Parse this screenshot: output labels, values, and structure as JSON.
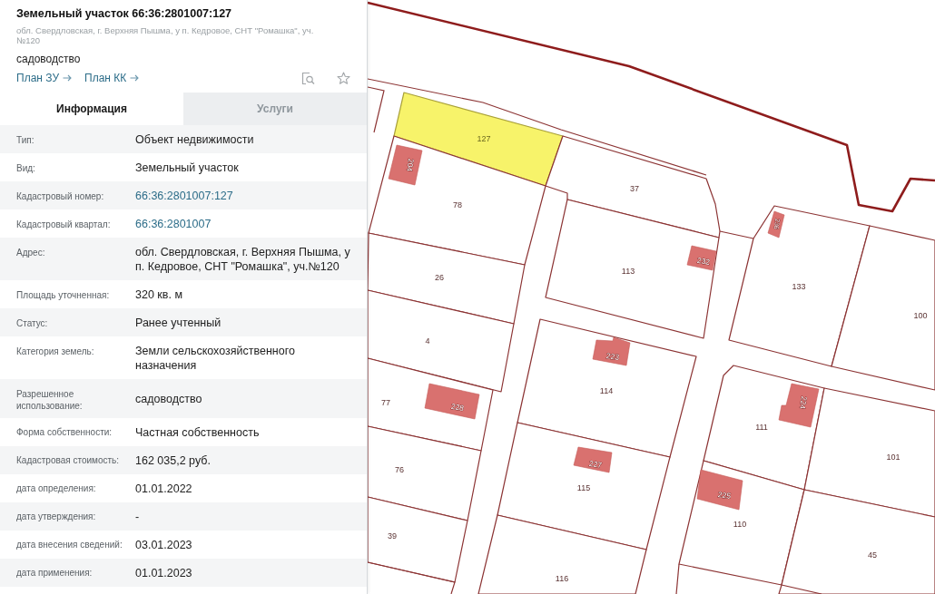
{
  "panel": {
    "title": "Земельный участок 66:36:2801007:127",
    "address": "обл. Свердловская, г. Верхняя Пышма, у п. Кедровое, СНТ \"Ромашка\", уч. №120",
    "usage": "садоводство",
    "links": [
      {
        "label": "План ЗУ"
      },
      {
        "label": "План КК"
      }
    ],
    "tabs": [
      {
        "label": "Информация",
        "selected": true
      },
      {
        "label": "Услуги",
        "selected": false
      }
    ],
    "rows": [
      {
        "label": "Тип:",
        "value": "Объект недвижимости",
        "kind": "text"
      },
      {
        "label": "Вид:",
        "value": "Земельный участок",
        "kind": "text"
      },
      {
        "label": "Кадастровый номер:",
        "value": "66:36:2801007:127",
        "kind": "link"
      },
      {
        "label": "Кадастровый квартал:",
        "value": "66:36:2801007",
        "kind": "link"
      },
      {
        "label": "Адрес:",
        "value": "обл. Свердловская, г. Верхняя Пышма, у п. Кедровое, СНТ \"Ромашка\", уч.№120",
        "kind": "text"
      },
      {
        "label": "Площадь уточненная:",
        "value": "320 кв. м",
        "kind": "text"
      },
      {
        "label": "Статус:",
        "value": "Ранее учтенный",
        "kind": "text"
      },
      {
        "label": "Категория земель:",
        "value": "Земли сельскохозяйственного назначения",
        "kind": "text"
      },
      {
        "label": "Разрешенное использование:",
        "value": "садоводство",
        "kind": "text"
      },
      {
        "label": "Форма собственности:",
        "value": "Частная собственность",
        "kind": "text"
      },
      {
        "label": "Кадастровая стоимость:",
        "value": "162 035,2 руб.",
        "kind": "text"
      },
      {
        "label": "дата определения:",
        "value": "01.01.2022",
        "kind": "text"
      },
      {
        "label": "дата утверждения:",
        "value": "-",
        "kind": "text"
      },
      {
        "label": "дата внесения сведений:",
        "value": "03.01.2023",
        "kind": "text"
      },
      {
        "label": "дата применения:",
        "value": "01.01.2023",
        "kind": "text"
      }
    ]
  },
  "map": {
    "parcels": [
      {
        "label": "127",
        "selected": true
      },
      {
        "label": "78",
        "selected": false
      },
      {
        "label": "37",
        "selected": false
      },
      {
        "label": "26",
        "selected": false
      },
      {
        "label": "113",
        "selected": false
      },
      {
        "label": "133",
        "selected": false
      },
      {
        "label": "100",
        "selected": false
      },
      {
        "label": "4",
        "selected": false
      },
      {
        "label": "114",
        "selected": false
      },
      {
        "label": "77",
        "selected": false
      },
      {
        "label": "111",
        "selected": false
      },
      {
        "label": "101",
        "selected": false
      },
      {
        "label": "76",
        "selected": false
      },
      {
        "label": "115",
        "selected": false
      },
      {
        "label": "110",
        "selected": false
      },
      {
        "label": "39",
        "selected": false
      },
      {
        "label": "116",
        "selected": false
      },
      {
        "label": "45",
        "selected": false
      }
    ],
    "buildings": [
      {
        "label": "204"
      },
      {
        "label": "236"
      },
      {
        "label": "232"
      },
      {
        "label": "223"
      },
      {
        "label": "224"
      },
      {
        "label": "228"
      },
      {
        "label": "227"
      },
      {
        "label": "225"
      }
    ]
  }
}
